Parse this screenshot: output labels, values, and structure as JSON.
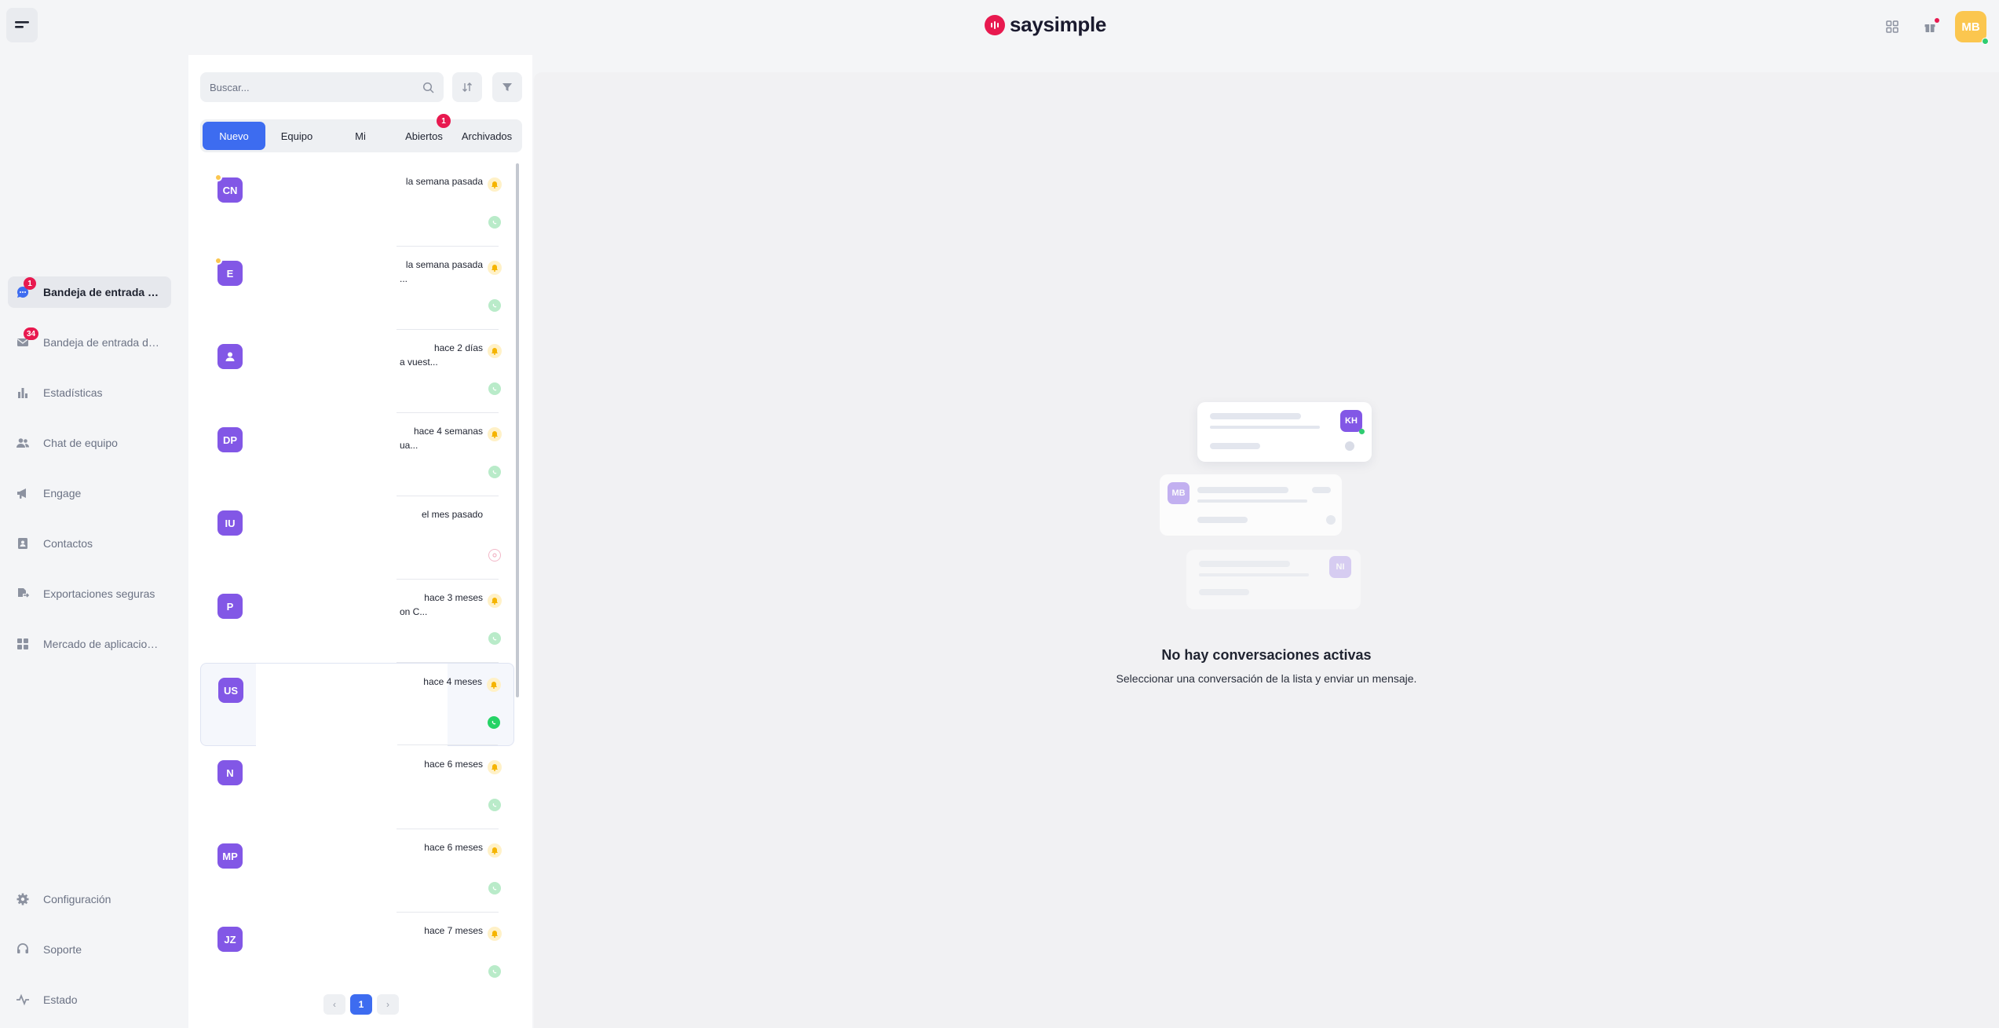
{
  "app": {
    "logo_text": "saysimple",
    "user_initials": "MB",
    "accent": "#3d6cf0",
    "brand": "#e8194f"
  },
  "header": {
    "icons": [
      "menu-icon",
      "apps-grid-icon",
      "gift-icon"
    ]
  },
  "sidebar": {
    "top_items": [
      {
        "name": "whatsapp-inbox",
        "label": "Bandeja de entrada de WhatsApp",
        "badge": "1",
        "icon": "chat-icon",
        "active": true
      },
      {
        "name": "email-inbox",
        "label": "Bandeja de entrada de correo",
        "badge": "34",
        "icon": "mail-icon",
        "active": false
      },
      {
        "name": "statistics",
        "label": "Estadísticas",
        "icon": "bar-chart-icon"
      },
      {
        "name": "team-chat",
        "label": "Chat de equipo",
        "icon": "users-icon"
      },
      {
        "name": "engage",
        "label": "Engage",
        "icon": "megaphone-icon"
      },
      {
        "name": "contacts",
        "label": "Contactos",
        "icon": "contact-book-icon"
      },
      {
        "name": "secure-exports",
        "label": "Exportaciones seguras",
        "icon": "export-icon"
      },
      {
        "name": "app-market",
        "label": "Mercado de aplicaciones",
        "icon": "grid-icon"
      }
    ],
    "bottom_items": [
      {
        "name": "settings",
        "label": "Configuración",
        "icon": "gear-icon"
      },
      {
        "name": "support",
        "label": "Soporte",
        "icon": "headset-icon"
      },
      {
        "name": "status",
        "label": "Estado",
        "icon": "pulse-icon"
      }
    ]
  },
  "list": {
    "search_placeholder": "Buscar...",
    "tabs": [
      {
        "label": "Nuevo",
        "active": true
      },
      {
        "label": "Equipo"
      },
      {
        "label": "Mi"
      },
      {
        "label": "Abiertos",
        "badge": "1"
      },
      {
        "label": "Archivados"
      }
    ],
    "conversations": [
      {
        "initials": "CN",
        "time": "la semana pasada",
        "snippet": "",
        "starred": true,
        "bell": true,
        "channel": "whatsapp-faded"
      },
      {
        "initials": "E",
        "time": "la semana pasada",
        "snippet": "...",
        "starred": true,
        "bell": true,
        "channel": "whatsapp-faded"
      },
      {
        "initials": "",
        "time": "hace 2 días",
        "snippet": "a vuest...",
        "person": true,
        "bell": true,
        "channel": "whatsapp-faded"
      },
      {
        "initials": "DP",
        "time": "hace 4 semanas",
        "snippet": "ua...",
        "bell": true,
        "channel": "whatsapp-faded"
      },
      {
        "initials": "IU",
        "time": "el mes pasado",
        "snippet": "",
        "bell": false,
        "channel": "instagram"
      },
      {
        "initials": "P",
        "time": "hace 3 meses",
        "snippet": "on C...",
        "bell": true,
        "channel": "whatsapp-faded"
      },
      {
        "initials": "US",
        "time": "hace 4 meses",
        "snippet": "",
        "bell": true,
        "channel": "whatsapp",
        "selected": true
      },
      {
        "initials": "N",
        "time": "hace 6 meses",
        "snippet": "",
        "bell": true,
        "channel": "whatsapp-faded"
      },
      {
        "initials": "MP",
        "time": "hace 6 meses",
        "snippet": "",
        "bell": true,
        "channel": "whatsapp-faded"
      },
      {
        "initials": "JZ",
        "time": "hace 7 meses",
        "snippet": "",
        "bell": true,
        "channel": "whatsapp-faded"
      }
    ],
    "pagination": {
      "prev": "‹",
      "current": "1",
      "next": "›"
    }
  },
  "empty_state": {
    "title": "No hay conversaciones activas",
    "subtitle": "Seleccionar una conversación de la lista y enviar un mensaje.",
    "avatars": [
      "KH",
      "MB",
      "NI"
    ]
  }
}
